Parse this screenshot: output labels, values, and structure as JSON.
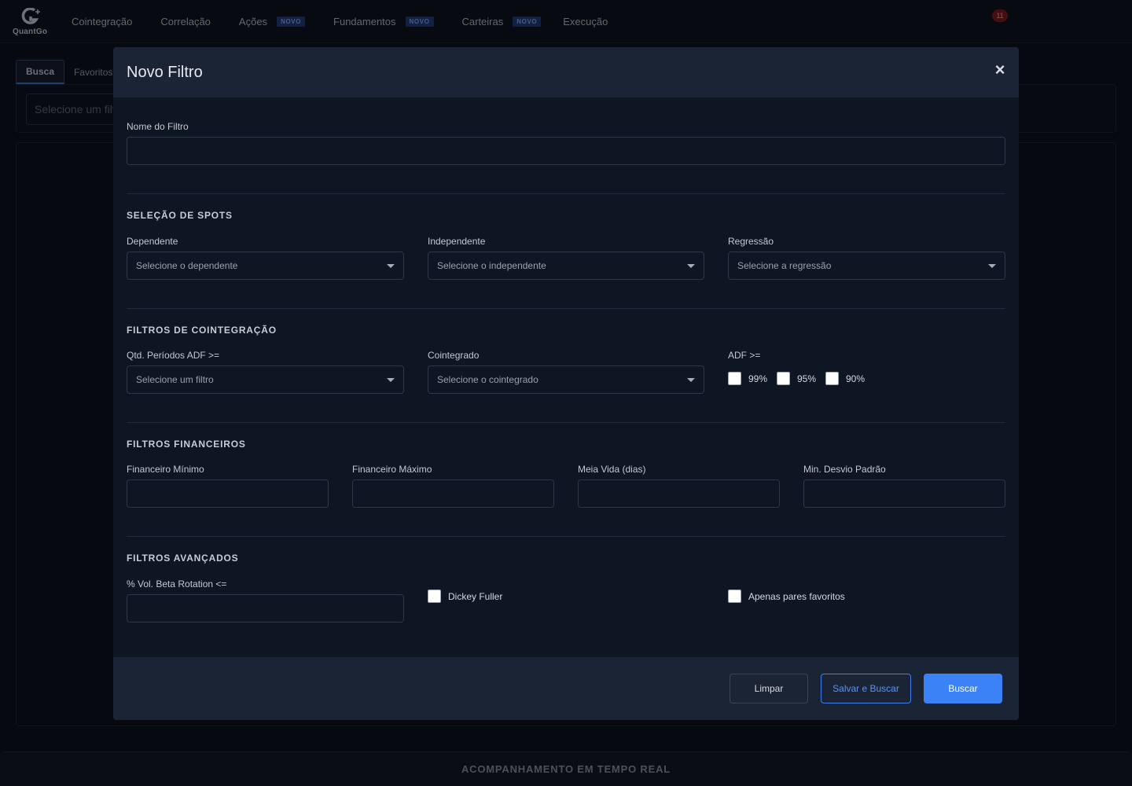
{
  "brand": {
    "logo_text": "QuantGo"
  },
  "nav": {
    "items": [
      {
        "label": "Cointegração",
        "badge": ""
      },
      {
        "label": "Correlação",
        "badge": ""
      },
      {
        "label": "Ações",
        "badge": "NOVO"
      },
      {
        "label": "Fundamentos",
        "badge": "NOVO"
      },
      {
        "label": "Carteiras",
        "badge": "NOVO"
      },
      {
        "label": "Execução",
        "badge": ""
      }
    ],
    "notification_count": "11"
  },
  "background": {
    "tabs": [
      "Busca",
      "Favoritos"
    ],
    "select_placeholder": "Selecione um filtro",
    "footer_text": "ACOMPANHAMENTO EM TEMPO REAL"
  },
  "modal": {
    "title": "Novo Filtro",
    "close_icon": "×",
    "filter_name": {
      "label": "Nome do Filtro",
      "value": ""
    },
    "spots": {
      "title": "SELEÇÃO DE SPOTS",
      "dependente": {
        "label": "Dependente",
        "placeholder": "Selecione o dependente"
      },
      "independente": {
        "label": "Independente",
        "placeholder": "Selecione o independente"
      },
      "regressao": {
        "label": "Regressão",
        "placeholder": "Selecione a regressão"
      }
    },
    "cointegracao": {
      "title": "FILTROS DE COINTEGRAÇÃO",
      "periodos": {
        "label": "Qtd. Períodos ADF >=",
        "placeholder": "Selecione um filtro"
      },
      "cointegrado": {
        "label": "Cointegrado",
        "placeholder": "Selecione o cointegrado"
      },
      "adf": {
        "label": "ADF >=",
        "options": [
          "99%",
          "95%",
          "90%"
        ]
      }
    },
    "financeiros": {
      "title": "FILTROS FINANCEIROS",
      "fields": [
        "Financeiro Mínimo",
        "Financeiro Máximo",
        "Meia Vida (dias)",
        "Min. Desvio Padrão"
      ]
    },
    "avancados": {
      "title": "FILTROS AVANÇADOS",
      "beta_label": "% Vol. Beta Rotation <=",
      "dickey_fuller": "Dickey Fuller",
      "favoritos": "Apenas pares favoritos"
    },
    "buttons": {
      "limpar": "Limpar",
      "salvar": "Salvar e Buscar",
      "buscar": "Buscar"
    }
  },
  "colors": {
    "accent": "#3b82f6",
    "badge_bg": "#1f3d7a",
    "notif_bg": "#7f1d1d"
  }
}
